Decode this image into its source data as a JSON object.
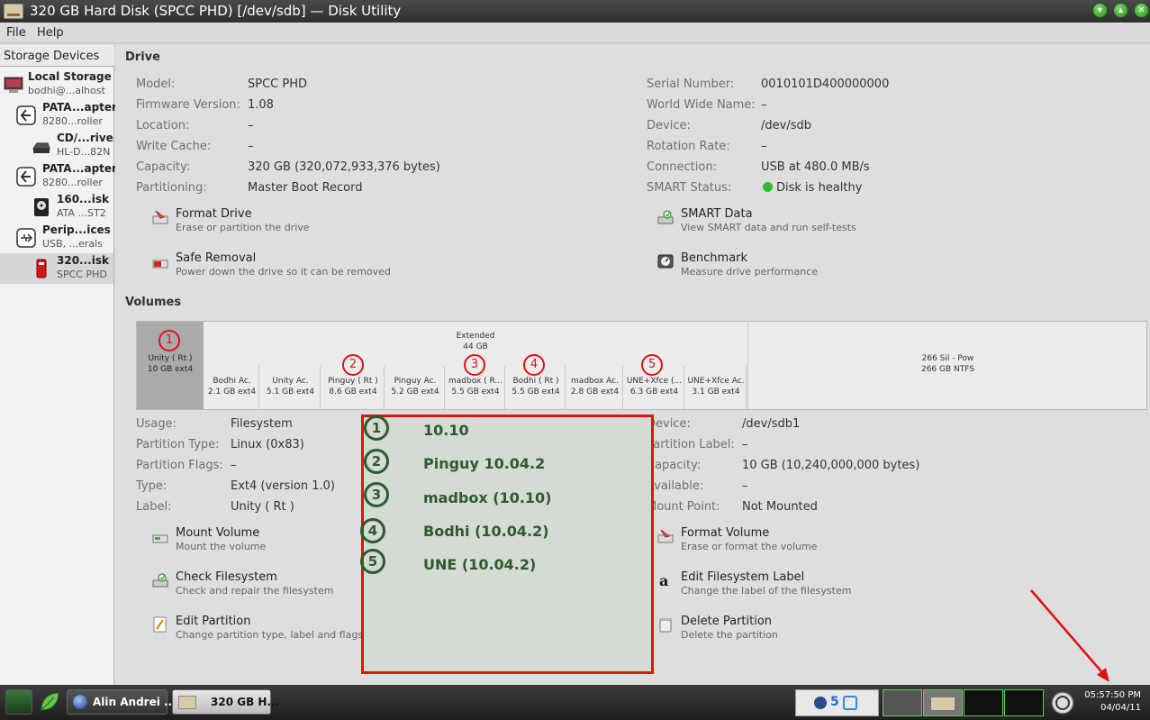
{
  "window": {
    "title": "320 GB Hard Disk (SPCC PHD) [/dev/sdb] — Disk Utility"
  },
  "menu": {
    "file": "File",
    "help": "Help"
  },
  "sidebar": {
    "header": "Storage Devices",
    "items": [
      {
        "name": "Local Storage",
        "sub": "bodhi@...alhost",
        "icon": "computer-icon"
      },
      {
        "name": "PATA...apter",
        "sub": "8280...roller",
        "icon": "controller-icon"
      },
      {
        "name": "CD/...rive",
        "sub": "HL-D...82N",
        "icon": "optical-drive-icon"
      },
      {
        "name": "PATA...apter",
        "sub": "8280...roller",
        "icon": "controller-icon"
      },
      {
        "name": "160...isk",
        "sub": "ATA ...ST2",
        "icon": "hard-disk-icon"
      },
      {
        "name": "Perip...ices",
        "sub": "USB, ...erals",
        "icon": "usb-icon"
      },
      {
        "name": "320...isk",
        "sub": "SPCC PHD",
        "icon": "usb-disk-icon"
      }
    ]
  },
  "drive": {
    "section_title": "Drive",
    "left": [
      {
        "label": "Model:",
        "value": "SPCC PHD"
      },
      {
        "label": "Firmware Version:",
        "value": "1.08"
      },
      {
        "label": "Location:",
        "value": "–"
      },
      {
        "label": "Write Cache:",
        "value": "–"
      },
      {
        "label": "Capacity:",
        "value": "320 GB (320,072,933,376 bytes)"
      },
      {
        "label": "Partitioning:",
        "value": "Master Boot Record"
      }
    ],
    "right": [
      {
        "label": "Serial Number:",
        "value": "0010101D400000000"
      },
      {
        "label": "World Wide Name:",
        "value": "–"
      },
      {
        "label": "Device:",
        "value": "/dev/sdb"
      },
      {
        "label": "Rotation Rate:",
        "value": "–"
      },
      {
        "label": "Connection:",
        "value": "USB at 480.0 MB/s"
      },
      {
        "label": "SMART Status:",
        "value": "Disk is healthy"
      }
    ],
    "actions": [
      {
        "title": "Format Drive",
        "desc": "Erase or partition the drive"
      },
      {
        "title": "SMART Data",
        "desc": "View SMART data and run self-tests"
      },
      {
        "title": "Safe Removal",
        "desc": "Power down the drive so it can be removed"
      },
      {
        "title": "Benchmark",
        "desc": "Measure drive performance"
      }
    ]
  },
  "volumes": {
    "section_title": "Volumes",
    "unity": {
      "l1": "Unity ( Rt )",
      "l2": "10 GB ext4"
    },
    "extended": {
      "l1": "Extended",
      "l2": "44 GB"
    },
    "logical": [
      {
        "l1": "Bodhi Ac.",
        "l2": "2.1 GB ext4"
      },
      {
        "l1": "Unity Ac.",
        "l2": "5.1 GB ext4"
      },
      {
        "l1": "Pinguy ( Rt )",
        "l2": "8.6 GB ext4"
      },
      {
        "l1": "Pinguy Ac.",
        "l2": "5.2 GB ext4"
      },
      {
        "l1": "madbox ( R...",
        "l2": "5.5 GB ext4"
      },
      {
        "l1": "Bodhi ( Rt )",
        "l2": "5.5 GB ext4"
      },
      {
        "l1": "madbox Ac.",
        "l2": "2.8 GB ext4"
      },
      {
        "l1": "UNE+Xfce (...",
        "l2": "6.3 GB ext4"
      },
      {
        "l1": "UNE+Xfce Ac.",
        "l2": "3.1 GB ext4"
      }
    ],
    "ntfs": {
      "l1": "266 Sil - Pow",
      "l2": "266 GB NTFS"
    },
    "markers": [
      "1",
      "2",
      "3",
      "4",
      "5"
    ]
  },
  "volume_details": {
    "left": [
      {
        "label": "Usage:",
        "value": "Filesystem"
      },
      {
        "label": "Partition Type:",
        "value": "Linux (0x83)"
      },
      {
        "label": "Partition Flags:",
        "value": "–"
      },
      {
        "label": "Type:",
        "value": "Ext4 (version 1.0)"
      },
      {
        "label": "Label:",
        "value": "Unity ( Rt )"
      }
    ],
    "right": [
      {
        "label": "Device:",
        "value": "/dev/sdb1"
      },
      {
        "label": "Partition Label:",
        "value": "–"
      },
      {
        "label": "Capacity:",
        "value": "10 GB (10,240,000,000 bytes)"
      },
      {
        "label": "Available:",
        "value": "–"
      },
      {
        "label": "Mount Point:",
        "value": "Not Mounted"
      }
    ],
    "actions": [
      {
        "title": "Mount Volume",
        "desc": "Mount the volume"
      },
      {
        "title": "Format Volume",
        "desc": "Erase or format the volume"
      },
      {
        "title": "Check Filesystem",
        "desc": "Check and repair the filesystem"
      },
      {
        "title": "Edit Filesystem Label",
        "desc": "Change the label of the filesystem"
      },
      {
        "title": "Edit Partition",
        "desc": "Change partition type, label and flags"
      },
      {
        "title": "Delete Partition",
        "desc": "Delete the partition"
      }
    ]
  },
  "overlay": {
    "items": [
      {
        "num": "1",
        "text": "10.10"
      },
      {
        "num": "2",
        "text": "Pinguy 10.04.2"
      },
      {
        "num": "3",
        "text": "madbox (10.10)"
      },
      {
        "num": "4",
        "text": "Bodhi (10.04.2)"
      },
      {
        "num": "5",
        "text": "UNE (10.04.2)"
      }
    ]
  },
  "taskbar": {
    "tasks": [
      {
        "label": "Alin Andrei ..."
      },
      {
        "label": "320 GB H..."
      }
    ],
    "clock": {
      "time": "05:57:50 PM",
      "date": "04/04/11"
    }
  },
  "colors": {
    "annotation_red": "#e01212",
    "annotation_green": "#2e5a2e",
    "healthy": "#2ebd2e"
  }
}
